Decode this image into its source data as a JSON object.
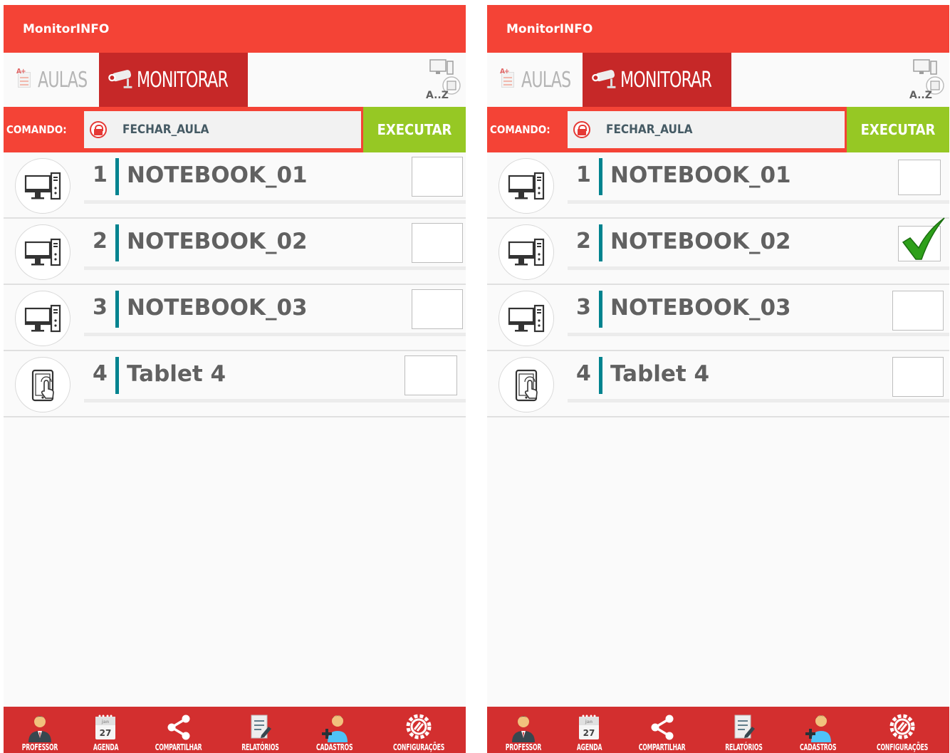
{
  "app": {
    "title": "MonitorINFO"
  },
  "tabs": {
    "aulas": "AULAS",
    "monitorar": "MONITORAR",
    "aulas_grade": "A+"
  },
  "sort_button": {
    "label": "A..Z"
  },
  "command": {
    "label": "COMANDO:",
    "value": "FECHAR_AULA",
    "execute": "EXECUTAR"
  },
  "screens": [
    {
      "devices": [
        {
          "number": "1",
          "name": "NOTEBOOK_01",
          "type": "computer",
          "checked": false
        },
        {
          "number": "2",
          "name": "NOTEBOOK_02",
          "type": "computer",
          "checked": false
        },
        {
          "number": "3",
          "name": "NOTEBOOK_03",
          "type": "computer",
          "checked": false
        },
        {
          "number": "4",
          "name": "Tablet 4",
          "type": "tablet",
          "checked": false
        }
      ]
    },
    {
      "devices": [
        {
          "number": "1",
          "name": "NOTEBOOK_01",
          "type": "computer",
          "checked": false
        },
        {
          "number": "2",
          "name": "NOTEBOOK_02",
          "type": "computer",
          "checked": true
        },
        {
          "number": "3",
          "name": "NOTEBOOK_03",
          "type": "computer",
          "checked": false
        },
        {
          "number": "4",
          "name": "Tablet 4",
          "type": "tablet",
          "checked": false
        }
      ]
    }
  ],
  "bottom_nav": [
    {
      "label": "PROFESSOR",
      "icon": "professor-icon"
    },
    {
      "label": "AGENDA",
      "icon": "calendar-icon",
      "calendar_month": "jan",
      "calendar_day": "27"
    },
    {
      "label": "COMPARTILHAR",
      "icon": "share-icon"
    },
    {
      "label": "RELATÓRIOS",
      "icon": "report-icon"
    },
    {
      "label": "CADASTROS",
      "icon": "add-user-icon"
    },
    {
      "label": "CONFIGURAÇÕES",
      "icon": "settings-icon"
    }
  ],
  "colors": {
    "appbar": "#f44336",
    "tab_active": "#c62828",
    "execute": "#96c824",
    "separator": "#00838f",
    "bottom_nav": "#d32f2f",
    "check": "#2ea01a"
  }
}
